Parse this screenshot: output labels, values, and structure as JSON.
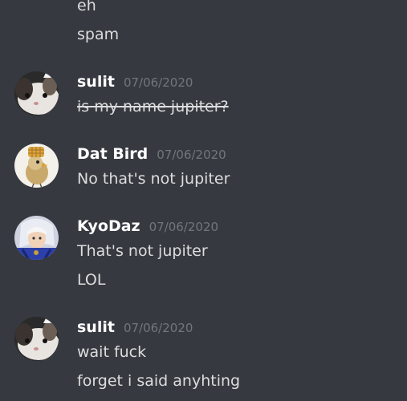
{
  "chat": {
    "top_lines": [
      "eh",
      "spam"
    ],
    "messages": [
      {
        "username": "sulit",
        "timestamp": "07/06/2020",
        "avatar_icon": "cat-photo-avatar",
        "lines": [
          "is my name jupiter?"
        ],
        "strikethrough": true
      },
      {
        "username": "Dat Bird",
        "timestamp": "07/06/2020",
        "avatar_icon": "bird-waffle-avatar",
        "lines": [
          "No that's not jupiter"
        ]
      },
      {
        "username": "KyoDaz",
        "timestamp": "07/06/2020",
        "avatar_icon": "anime-character-avatar",
        "lines": [
          "That's not jupiter",
          "LOL"
        ]
      },
      {
        "username": "sulit",
        "timestamp": "07/06/2020",
        "avatar_icon": "cat-photo-avatar",
        "lines": [
          "wait fuck",
          "forget i said anyhting"
        ]
      }
    ]
  },
  "colors": {
    "background": "#36393f",
    "message_text": "#dcddde",
    "username": "#ffffff",
    "timestamp": "#72767d"
  }
}
